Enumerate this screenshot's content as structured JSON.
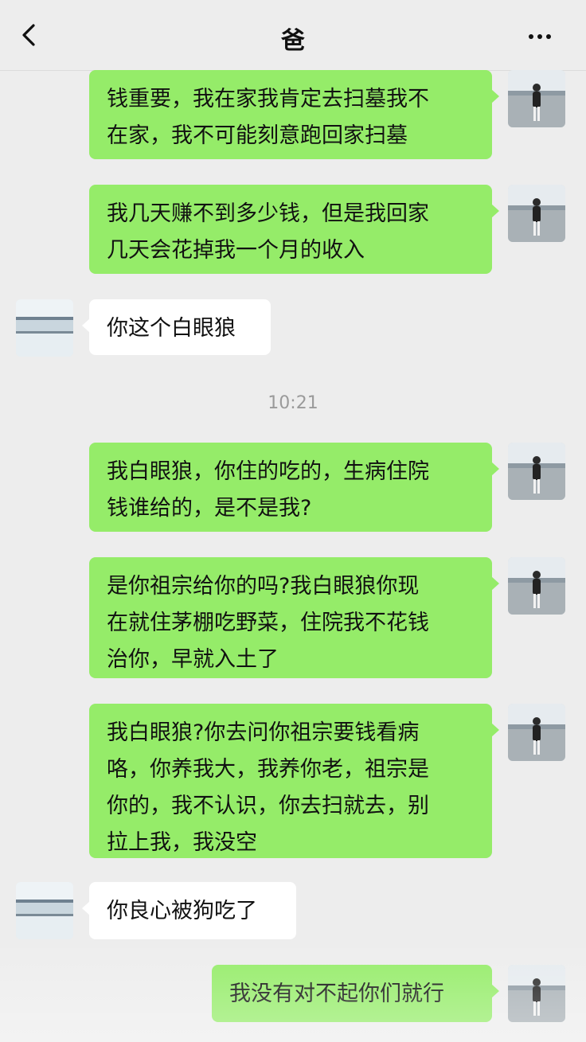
{
  "header": {
    "title": "爸",
    "back_icon": "chevron-left-icon",
    "more_icon": "ellipsis-icon"
  },
  "colors": {
    "sent_bubble": "#95ec69",
    "received_bubble": "#ffffff",
    "background": "#ededed"
  },
  "messages": [
    {
      "side": "right",
      "text": "钱重要，我在家我肯定去扫墓我不\n在家，我不可能刻意跑回家扫墓"
    },
    {
      "side": "right",
      "text": "我几天赚不到多少钱，但是我回家\n几天会花掉我一个月的收入"
    },
    {
      "side": "left",
      "text": "你这个白眼狼"
    },
    {
      "side": "right",
      "text": "我白眼狼，你住的吃的，生病住院\n钱谁给的，是不是我?"
    },
    {
      "side": "right",
      "text": "是你祖宗给你的吗?我白眼狼你现\n在就住茅棚吃野菜，住院我不花钱\n治你，早就入土了"
    },
    {
      "side": "right",
      "text": "我白眼狼?你去问你祖宗要钱看病\n咯，你养我大，我养你老，祖宗是\n你的，我不认识，你去扫就去，别\n拉上我，我没空"
    },
    {
      "side": "left",
      "text": "你良心被狗吃了"
    },
    {
      "side": "right",
      "text": "我没有对不起你们就行"
    }
  ],
  "timestamp": "10:21"
}
